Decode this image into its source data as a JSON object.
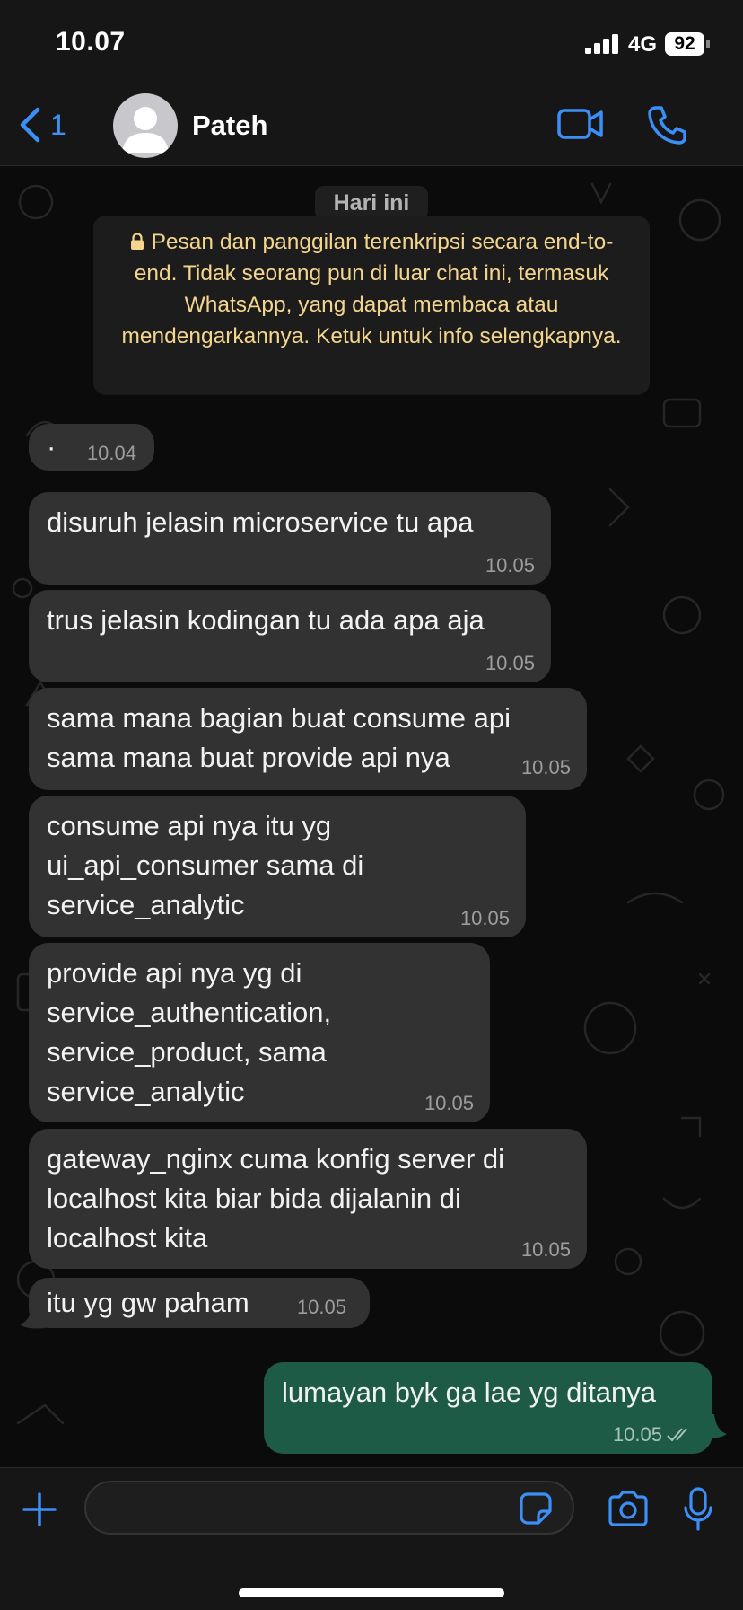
{
  "status_bar": {
    "time": "10.07",
    "network": "4G",
    "battery": "92"
  },
  "header": {
    "back_count": "1",
    "contact_name": "Pateh"
  },
  "chat": {
    "date_label": "Hari ini",
    "e2e_notice": "Pesan dan panggilan terenkripsi secara end-to-end. Tidak seorang pun di luar chat ini, termasuk WhatsApp, yang dapat membaca atau mendengarkannya. Ketuk untuk info selengkapnya.",
    "messages": [
      {
        "direction": "in",
        "text": "·",
        "time": "10.04"
      },
      {
        "direction": "in",
        "text": "disuruh jelasin microservice tu apa",
        "time": "10.05"
      },
      {
        "direction": "in",
        "text": "trus jelasin kodingan tu ada apa aja",
        "time": "10.05"
      },
      {
        "direction": "in",
        "text": "sama mana bagian buat consume api sama mana buat provide api nya",
        "time": "10.05"
      },
      {
        "direction": "in",
        "text": "consume api nya itu yg ui_api_consumer sama di service_analytic",
        "time": "10.05"
      },
      {
        "direction": "in",
        "text": "provide api nya yg di service_authentication, service_product, sama service_analytic",
        "time": "10.05"
      },
      {
        "direction": "in",
        "text": "gateway_nginx cuma konfig server di localhost kita biar bida dijalanin di localhost kita",
        "time": "10.05"
      },
      {
        "direction": "in",
        "text": "itu yg gw paham",
        "time": "10.05"
      },
      {
        "direction": "out",
        "text": "lumayan byk ga lae yg ditanya",
        "time": "10.05",
        "status": "delivered"
      }
    ]
  },
  "input": {
    "placeholder": ""
  },
  "icons": {
    "back": "chevron-left-icon",
    "video": "video-camera-icon",
    "call": "phone-icon",
    "plus": "plus-icon",
    "sticker": "sticker-icon",
    "camera": "camera-icon",
    "mic": "microphone-icon",
    "lock": "lock-icon",
    "ticks": "double-check-icon"
  },
  "colors": {
    "accent": "#3b8ff7",
    "incoming_bubble": "#323232",
    "outgoing_bubble": "#1e5b47",
    "notice_text": "#f4d58d",
    "background": "#0b0b0b",
    "bar": "#161616"
  }
}
